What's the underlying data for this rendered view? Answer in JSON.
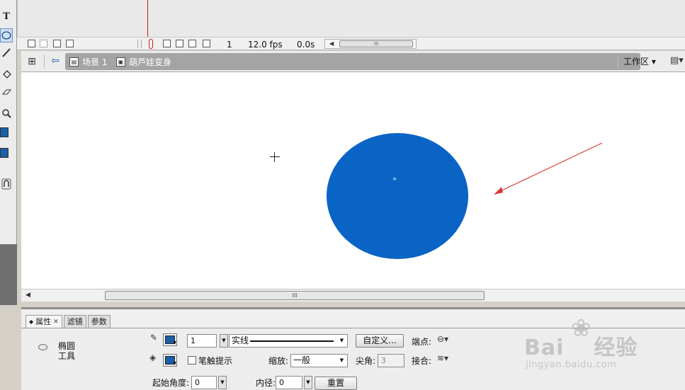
{
  "toolbox": {
    "text_tool": "T",
    "tools": [
      "text-tool",
      "oval-tool",
      "brush-tool",
      "paint-bucket-tool",
      "eraser-tool",
      "zoom-tool",
      "stroke-color",
      "fill-color",
      "snap-magnet"
    ]
  },
  "timeline": {
    "frame": "1",
    "fps": "12.0 fps",
    "time": "0.0s",
    "scroll_grip": "III"
  },
  "editbar": {
    "scene": "场景 1",
    "symbol": "葫芦娃变身",
    "workspace": "工作区"
  },
  "stage": {
    "shape_color": "#0a64c6",
    "scroll_grip": "III"
  },
  "properties": {
    "tabs": [
      {
        "label": "属性",
        "active": true,
        "closable": true
      },
      {
        "label": "滤镜",
        "active": false
      },
      {
        "label": "参数",
        "active": false
      }
    ],
    "tool_name_line1": "椭圆",
    "tool_name_line2": "工具",
    "stroke_color": "#1a5fa8",
    "fill_color": "#1a5fa8",
    "stroke_width": "1",
    "stroke_style": "实线",
    "custom_button": "自定义...",
    "cap_label": "端点:",
    "stroke_hint_label": "笔触提示",
    "scale_label": "缩放:",
    "scale_value": "一般",
    "miter_label": "尖角:",
    "miter_value": "3",
    "join_label": "接合:",
    "start_angle_label": "起始角度:",
    "start_angle_value": "0",
    "inner_radius_label": "内径:",
    "inner_radius_value": "0",
    "reset_button": "重置"
  },
  "watermark": {
    "brand": "Bai",
    "brand_suffix": "经验",
    "url": "jingyan.baidu.com"
  }
}
